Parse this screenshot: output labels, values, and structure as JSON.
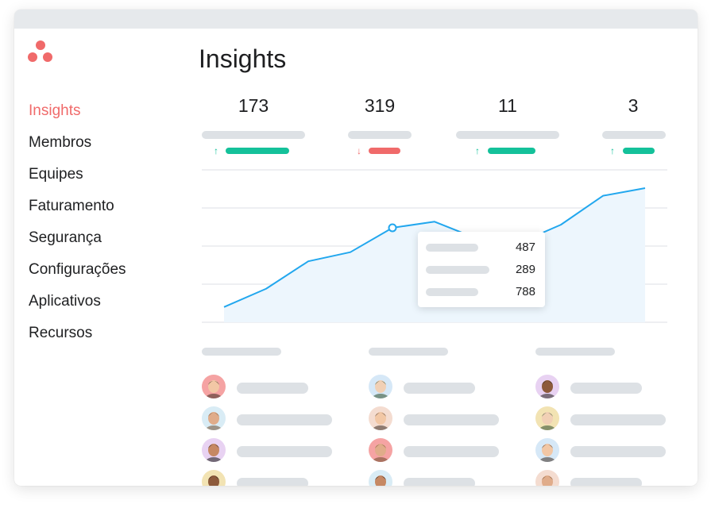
{
  "brand": {
    "logo_icon": "asana-logo-icon",
    "color": "#f06a6a"
  },
  "sidebar": {
    "items": [
      {
        "label": "Insights",
        "active": true
      },
      {
        "label": "Membros",
        "active": false
      },
      {
        "label": "Equipes",
        "active": false
      },
      {
        "label": "Faturamento",
        "active": false
      },
      {
        "label": "Segurança",
        "active": false
      },
      {
        "label": "Configurações",
        "active": false
      },
      {
        "label": "Aplicativos",
        "active": false
      },
      {
        "label": "Recursos",
        "active": false
      }
    ]
  },
  "main": {
    "title": "Insights",
    "stats": [
      {
        "value": "173",
        "trend": "up",
        "trend_icon": "arrow-up-icon"
      },
      {
        "value": "319",
        "trend": "down",
        "trend_icon": "arrow-down-icon"
      },
      {
        "value": "11",
        "trend": "up",
        "trend_icon": "arrow-up-icon"
      },
      {
        "value": "3",
        "trend": "up",
        "trend_icon": "arrow-up-icon"
      }
    ],
    "tooltip": {
      "values": [
        "487",
        "289",
        "788"
      ]
    }
  },
  "colors": {
    "up": "#14c19a",
    "down": "#f06a6a",
    "line": "#22a7ee",
    "area": "#edf6fd",
    "placeholder": "#dde1e5"
  },
  "chart_data": {
    "type": "area",
    "x": [
      1,
      2,
      3,
      4,
      5,
      6,
      7,
      8,
      9,
      10,
      11
    ],
    "values": [
      10,
      22,
      40,
      46,
      62,
      66,
      55,
      52,
      64,
      83,
      88
    ],
    "highlighted_index": 4,
    "ylim": [
      0,
      100
    ],
    "grid": true,
    "title": "",
    "xlabel": "",
    "ylabel": ""
  },
  "members": {
    "columns": [
      {
        "avatars": [
          "avatar-1",
          "avatar-2",
          "avatar-3",
          "avatar-4"
        ]
      },
      {
        "avatars": [
          "avatar-5",
          "avatar-6",
          "avatar-7",
          "avatar-8"
        ]
      },
      {
        "avatars": [
          "avatar-9",
          "avatar-10",
          "avatar-11",
          "avatar-12"
        ]
      }
    ]
  }
}
